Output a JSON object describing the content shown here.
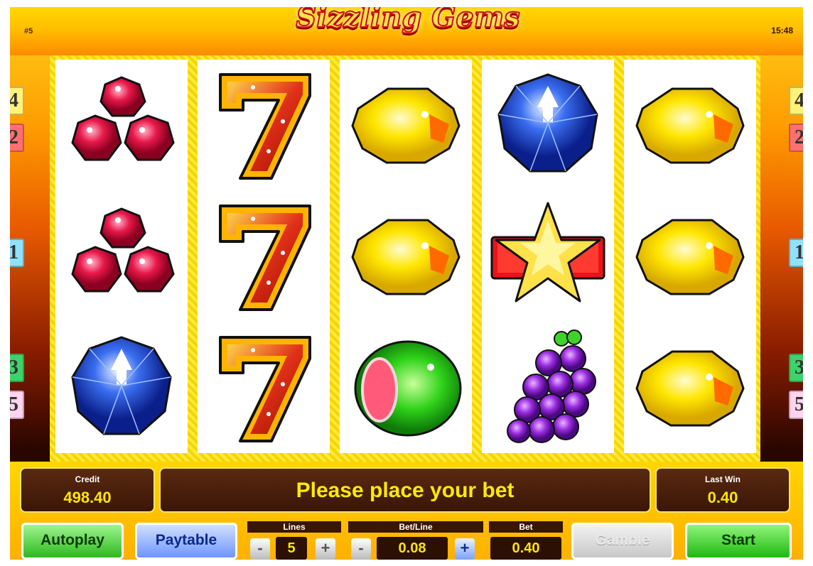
{
  "header": {
    "logo_text": "Sizzling Gems",
    "machine_id": "#5",
    "clock": "15:48"
  },
  "reels": [
    [
      "red-gem-cluster",
      "red-gem-cluster",
      "blue-diamond"
    ],
    [
      "seven",
      "seven",
      "seven"
    ],
    [
      "yellow-gem",
      "yellow-gem",
      "green-gem"
    ],
    [
      "blue-diamond",
      "star",
      "purple-grapes"
    ],
    [
      "yellow-gem",
      "yellow-gem",
      "yellow-gem"
    ]
  ],
  "paylines": {
    "left": [
      {
        "label": "4",
        "color": "#fff27a"
      },
      {
        "label": "2",
        "color": "#ff7070"
      },
      {
        "label": "1",
        "color": "#8fe2ff"
      },
      {
        "label": "3",
        "color": "#3ed36a"
      },
      {
        "label": "5",
        "color": "#ffd4f0"
      }
    ],
    "right": [
      {
        "label": "4",
        "color": "#fff27a"
      },
      {
        "label": "2",
        "color": "#ff7070"
      },
      {
        "label": "1",
        "color": "#8fe2ff"
      },
      {
        "label": "3",
        "color": "#3ed36a"
      },
      {
        "label": "5",
        "color": "#ffd4f0"
      }
    ]
  },
  "info": {
    "credit_label": "Credit",
    "credit_value": "498.40",
    "message": "Please place your bet",
    "last_win_label": "Last Win",
    "last_win_value": "0.40"
  },
  "controls": {
    "autoplay": "Autoplay",
    "paytable": "Paytable",
    "lines_label": "Lines",
    "lines_value": "5",
    "bet_line_label": "Bet/Line",
    "bet_line_value": "0.08",
    "bet_label": "Bet",
    "bet_value": "0.40",
    "minus": "-",
    "plus": "+",
    "gamble": "Gamble",
    "start": "Start"
  },
  "colors": {
    "autoplay": "#3acb2a",
    "paytable": "#2f5fe0",
    "gamble": "#d9d9d9",
    "start": "#2ed21a"
  }
}
